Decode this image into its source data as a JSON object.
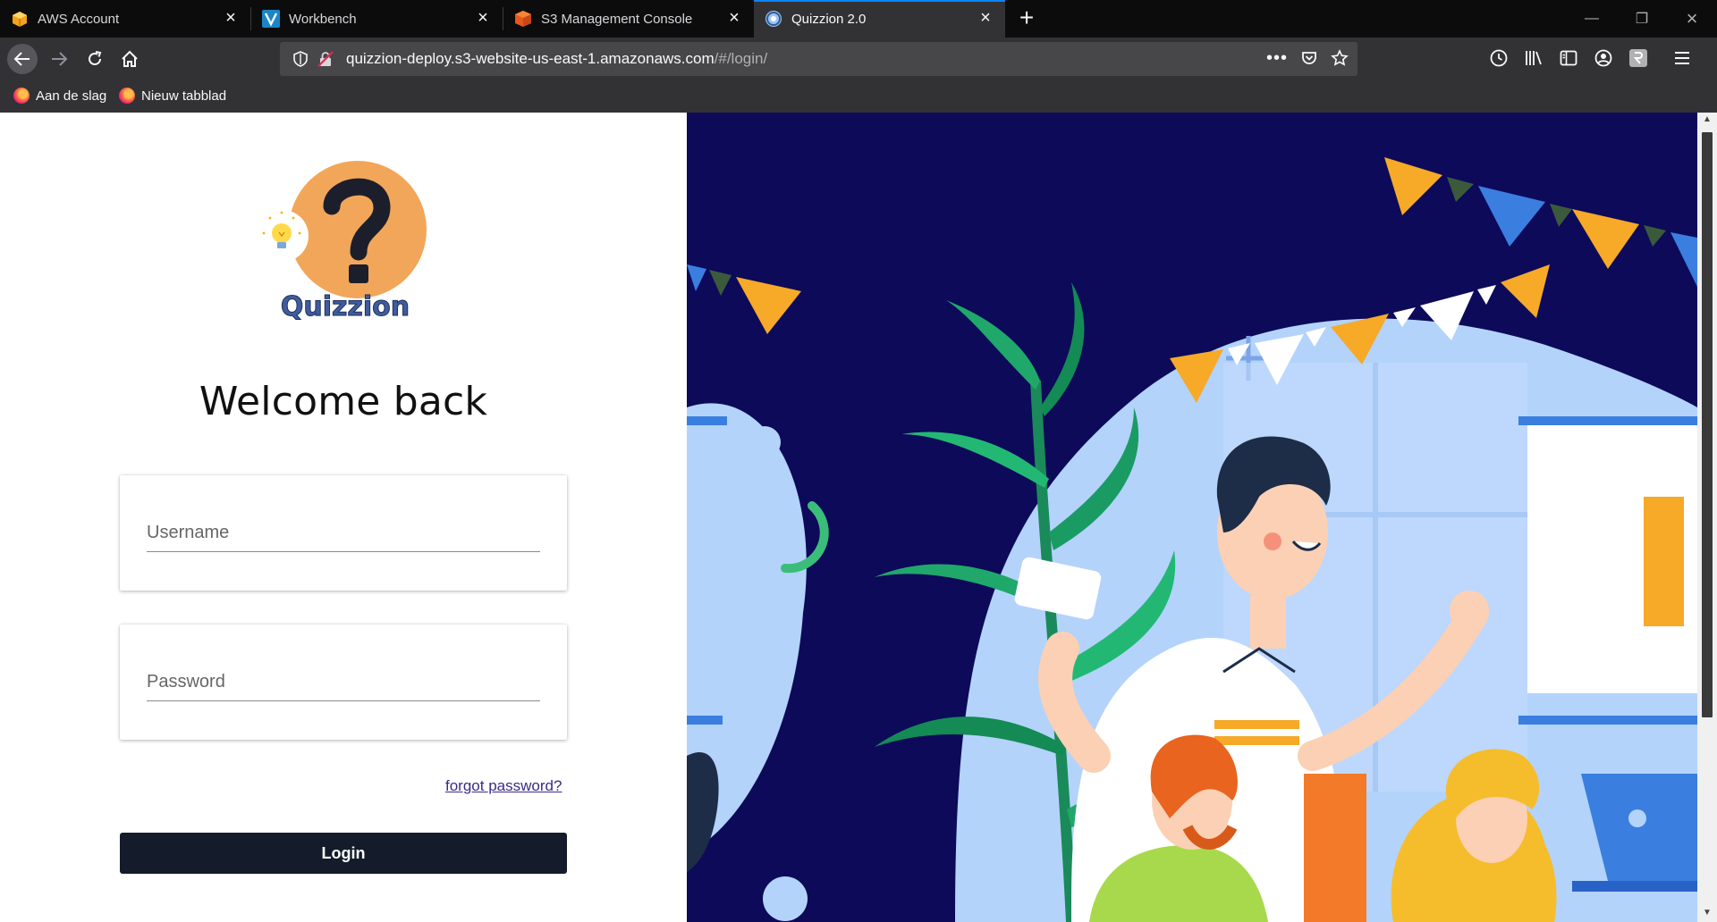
{
  "browser": {
    "tabs": [
      {
        "title": "AWS Account",
        "active": false
      },
      {
        "title": "Workbench",
        "active": false
      },
      {
        "title": "S3 Management Console",
        "active": false
      },
      {
        "title": "Quizzion 2.0",
        "active": true
      }
    ],
    "url": {
      "main": "quizzion-deploy.s3-website-us-east-1.amazonaws.com",
      "path": "/#/login/"
    },
    "bookmarks": [
      {
        "label": "Aan de slag"
      },
      {
        "label": "Nieuw tabblad"
      }
    ]
  },
  "login": {
    "logo_text": "Quizzion",
    "heading": "Welcome back",
    "username_placeholder": "Username",
    "password_placeholder": "Password",
    "forgot_label": "forgot password?",
    "login_label": "Login"
  },
  "colors": {
    "accent": "#0a84ff",
    "login_button": "#141c2b",
    "logo_orange": "#f2a65a",
    "illustration_bg": "#0d0a5a"
  }
}
